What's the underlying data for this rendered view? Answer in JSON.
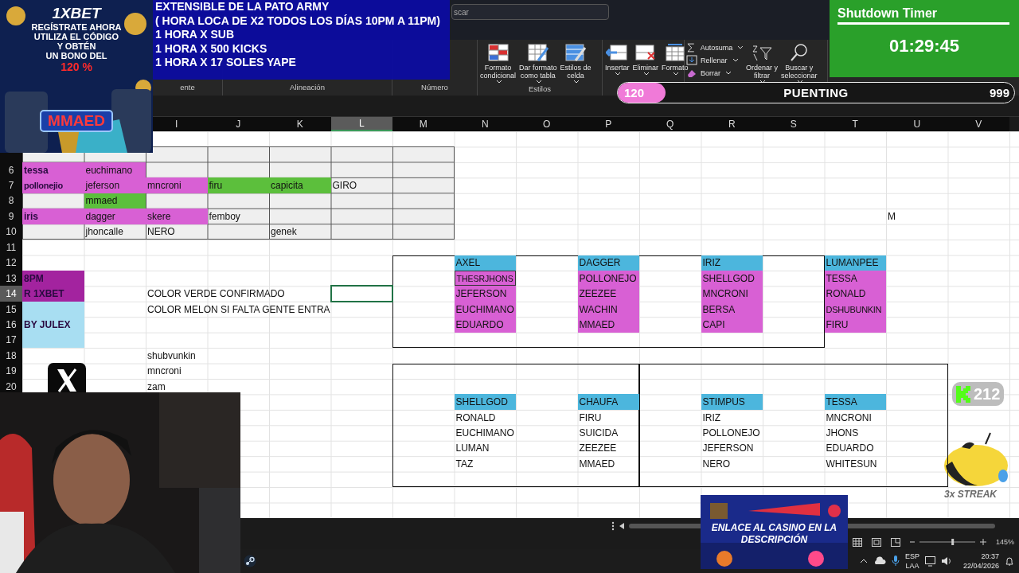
{
  "excel": {
    "search": {
      "value": "scar"
    },
    "ribbon": [
      {
        "label": "ente"
      },
      {
        "label": "Alineación"
      },
      {
        "label": "Número"
      },
      {
        "label": "Estilos",
        "buttons": [
          {
            "label": "Formato\ncondicional",
            "dropdown": true
          },
          {
            "label": "Dar formato\ncomo tabla",
            "dropdown": true
          },
          {
            "label": "Estilos de\ncelda",
            "dropdown": true
          }
        ]
      },
      {
        "buttons": [
          {
            "label": "Insertar",
            "dropdown": true
          },
          {
            "label": "Eliminar",
            "dropdown": true
          },
          {
            "label": "Formato",
            "dropdown": true
          }
        ]
      },
      {
        "small": [
          {
            "label": "Autosuma",
            "dropdown": true
          },
          {
            "label": "Rellenar",
            "dropdown": true
          },
          {
            "label": "Borrar",
            "dropdown": true
          }
        ],
        "buttons": [
          {
            "label": "Ordenar y\nfiltrar",
            "dropdown": true
          },
          {
            "label": "Buscar y\nseleccionar",
            "dropdown": true
          }
        ]
      }
    ],
    "columns": [
      {
        "letter": "I",
        "selected": false
      },
      {
        "letter": "J",
        "selected": false
      },
      {
        "letter": "K",
        "selected": false
      },
      {
        "letter": "L",
        "selected": true
      },
      {
        "letter": "M",
        "selected": false
      },
      {
        "letter": "N",
        "selected": false
      },
      {
        "letter": "O",
        "selected": false
      },
      {
        "letter": "P",
        "selected": false
      },
      {
        "letter": "Q",
        "selected": false
      },
      {
        "letter": "R",
        "selected": false
      },
      {
        "letter": "S",
        "selected": false
      },
      {
        "letter": "T",
        "selected": false
      },
      {
        "letter": "U",
        "selected": false
      },
      {
        "letter": "V",
        "selected": false
      }
    ],
    "rows": [
      {
        "number": "6",
        "selected": false,
        "cells": [
          {
            "text": "tessa",
            "color": "#d860d4"
          },
          {
            "text": "euchimano",
            "color": "#d860d4"
          }
        ]
      },
      {
        "number": "7",
        "selected": false,
        "cells": [
          {
            "text": "pollonejio",
            "color": "#d860d4"
          },
          {
            "text": "jeferson",
            "color": "#d860d4"
          },
          {
            "text": "mncroni",
            "color": "#d860d4"
          },
          {
            "text": "firu",
            "color": "#5cbf3c"
          },
          {
            "text": "capicita",
            "color": "#5cbf3c"
          },
          {
            "text": "GIRO"
          }
        ]
      },
      {
        "number": "8",
        "selected": false,
        "cells": [
          null,
          {
            "text": "mmaed",
            "color": "#5cbf3c"
          }
        ]
      },
      {
        "number": "9",
        "selected": false,
        "cells": [
          {
            "text": "iris",
            "color": "#d860d4"
          },
          {
            "text": "dagger",
            "color": "#d860d4"
          },
          {
            "text": "skere",
            "color": "#d860d4"
          },
          {
            "text": "femboy"
          },
          null,
          null,
          null,
          null,
          null,
          null,
          null,
          null,
          null,
          null,
          {
            "text": "M"
          }
        ]
      },
      {
        "number": "10",
        "selected": false,
        "cells": [
          null,
          {
            "text": "jhoncalle"
          },
          {
            "text": "NERO"
          },
          null,
          {
            "text": "genek"
          }
        ]
      },
      {
        "number": "11",
        "selected": false
      },
      {
        "number": "12",
        "selected": false,
        "cells": [
          null,
          null,
          null,
          null,
          null,
          null,
          null,
          {
            "text": "AXEL",
            "color": "#4cb6dd"
          },
          null,
          {
            "text": "DAGGER",
            "color": "#4cb6dd"
          },
          null,
          {
            "text": "IRIZ",
            "color": "#4cb6dd"
          },
          null,
          {
            "text": "LUMANPEE",
            "color": "#4cb6dd"
          }
        ]
      },
      {
        "number": "13",
        "selected": false,
        "cells": [
          {
            "text": "8PM",
            "color": "#a3239f"
          },
          null,
          null,
          null,
          null,
          null,
          null,
          {
            "text": "THESRJHONS",
            "color": "#d860d4",
            "outlined": true
          },
          null,
          {
            "text": "POLLONEJO",
            "color": "#d860d4"
          },
          null,
          {
            "text": "SHELLGOD",
            "color": "#d860d4"
          },
          null,
          {
            "text": "TESSA",
            "color": "#d860d4"
          }
        ]
      },
      {
        "number": "14",
        "selected": true,
        "cells": [
          {
            "text": "R  1XBET",
            "color": "#a3239f"
          },
          null,
          {
            "text": "COLOR VERDE CONFIRMADO"
          },
          null,
          null,
          null,
          null,
          {
            "text": "JEFERSON",
            "color": "#d860d4"
          },
          null,
          {
            "text": "ZEEZEE",
            "color": "#d860d4"
          },
          null,
          {
            "text": "MNCRONI",
            "color": "#d860d4"
          },
          null,
          {
            "text": "RONALD",
            "color": "#d860d4"
          }
        ]
      },
      {
        "number": "15",
        "selected": false,
        "cells": [
          {
            "color": "#a8def2"
          },
          null,
          {
            "text": "COLOR MELON SI FALTA GENTE ENTRA"
          },
          null,
          null,
          null,
          null,
          {
            "text": "EUCHIMANO",
            "color": "#d860d4"
          },
          null,
          {
            "text": "WACHIN",
            "color": "#d860d4"
          },
          null,
          {
            "text": "BERSA",
            "color": "#d860d4"
          },
          null,
          {
            "text": "DSHUBUNKIN",
            "color": "#d860d4"
          }
        ]
      },
      {
        "number": "16",
        "selected": false,
        "cells": [
          {
            "text": "BY JULEX",
            "color": "#a8def2"
          },
          null,
          null,
          null,
          null,
          null,
          null,
          {
            "text": "EDUARDO",
            "color": "#d860d4"
          },
          null,
          {
            "text": "MMAED",
            "color": "#d860d4"
          },
          null,
          {
            "text": "CAPI",
            "color": "#d860d4"
          },
          null,
          {
            "text": "FIRU",
            "color": "#d860d4"
          }
        ]
      },
      {
        "number": "17",
        "selected": false,
        "cells": [
          {
            "color": "#a8def2"
          }
        ]
      },
      {
        "number": "18",
        "selected": false,
        "cells": [
          null,
          null,
          {
            "text": "shubvunkin"
          }
        ]
      },
      {
        "number": "19",
        "selected": false,
        "cells": [
          null,
          null,
          {
            "text": "mncroni"
          }
        ]
      },
      {
        "number": "20",
        "selected": false,
        "cells": [
          null,
          null,
          {
            "text": "zam"
          }
        ]
      },
      {
        "cells": [
          null,
          null,
          null,
          null,
          null,
          null,
          null,
          {
            "text": "SHELLGOD",
            "color": "#4cb6dd"
          },
          null,
          {
            "text": "CHAUFA",
            "color": "#4cb6dd"
          },
          null,
          {
            "text": "STIMPUS",
            "color": "#4cb6dd"
          },
          null,
          {
            "text": "TESSA",
            "color": "#4cb6dd"
          }
        ]
      },
      {
        "cells": [
          null,
          null,
          null,
          null,
          null,
          null,
          null,
          {
            "text": "RONALD"
          },
          null,
          {
            "text": "FIRU"
          },
          null,
          {
            "text": "IRIZ"
          },
          null,
          {
            "text": "MNCRONI"
          }
        ]
      },
      {
        "cells": [
          null,
          null,
          null,
          null,
          null,
          null,
          null,
          {
            "text": "EUCHIMANO"
          },
          null,
          {
            "text": "SUICIDA"
          },
          null,
          {
            "text": "POLLONEJO"
          },
          null,
          {
            "text": "JHONS"
          }
        ]
      },
      {
        "cells": [
          null,
          null,
          null,
          null,
          null,
          null,
          null,
          {
            "text": "LUMAN"
          },
          null,
          {
            "text": "ZEEZEE"
          },
          null,
          {
            "text": "JEFERSON"
          },
          null,
          {
            "text": "EDUARDO"
          }
        ]
      },
      {
        "cells": [
          null,
          null,
          null,
          null,
          null,
          null,
          null,
          {
            "text": "TAZ"
          },
          null,
          {
            "text": "MMAED"
          },
          null,
          {
            "text": "NERO"
          },
          null,
          {
            "text": "WHITESUN"
          }
        ]
      }
    ],
    "status_bar": {
      "zoom": "145%",
      "level": 0.6
    }
  },
  "taskbar": {
    "language": [
      "ESP",
      "LAA"
    ],
    "time": "20:37",
    "date": "22/04/2026"
  },
  "overlays": {
    "ad": {
      "brand": "1XBET",
      "lines": [
        "REGÍSTRATE AHORA",
        "UTILIZA EL CÓDIGO",
        "Y OBTÉN",
        "UN BONO DEL"
      ],
      "bonus": "120 %",
      "code": "MMAED"
    },
    "banner": {
      "lines": [
        "EXTENSIBLE  DE LA PATO ARMY",
        "( HORA LOCA DE X2 TODOS LOS DÍAS 10PM A 11PM)",
        "1 HORA X SUB",
        "1 HORA X 500 KICKS",
        "1 HORA X 17 SOLES YAPE"
      ]
    },
    "timer": {
      "title": "Shutdown Timer",
      "time": "01:29:45"
    },
    "goal": {
      "current": "120",
      "title": "PUENTING",
      "target": "999",
      "level": 0.12
    },
    "followers": {
      "count": "212"
    },
    "streak": {
      "label": "3x STREAK"
    },
    "casino": {
      "text": "ENLACE AL CASINO EN LA DESCRIPCIÓN"
    }
  }
}
